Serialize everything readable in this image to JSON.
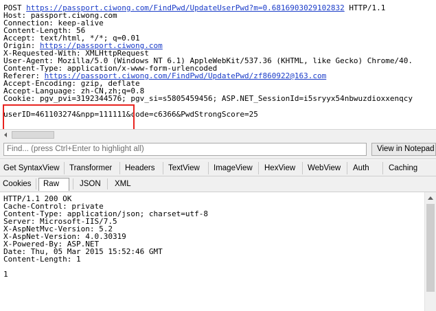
{
  "request": {
    "lines": [
      {
        "parts": [
          {
            "t": "POST "
          },
          {
            "t": "https://passport.ciwong.com/FindPwd/UpdateUserPwd?m=0.6816903029102832",
            "link": true
          },
          {
            "t": " HTTP/1.1"
          }
        ]
      },
      {
        "parts": [
          {
            "t": "Host: passport.ciwong.com"
          }
        ]
      },
      {
        "parts": [
          {
            "t": "Connection: keep-alive"
          }
        ]
      },
      {
        "parts": [
          {
            "t": "Content-Length: 56"
          }
        ]
      },
      {
        "parts": [
          {
            "t": "Accept: text/html, */*; q=0.01"
          }
        ]
      },
      {
        "parts": [
          {
            "t": "Origin: "
          },
          {
            "t": "https://passport.ciwong.com",
            "link": true
          }
        ]
      },
      {
        "parts": [
          {
            "t": "X-Requested-With: XMLHttpRequest"
          }
        ]
      },
      {
        "parts": [
          {
            "t": "User-Agent: Mozilla/5.0 (Windows NT 6.1) AppleWebKit/537.36 (KHTML, like Gecko) Chrome/40."
          }
        ]
      },
      {
        "parts": [
          {
            "t": "Content-Type: application/x-www-form-urlencoded"
          }
        ]
      },
      {
        "parts": [
          {
            "t": "Referer: "
          },
          {
            "t": "https://passport.ciwong.com/FindPwd/UpdatePwd/zf860922@163.com",
            "link": true
          }
        ]
      },
      {
        "parts": [
          {
            "t": "Accept-Encoding: gzip, deflate"
          }
        ]
      },
      {
        "parts": [
          {
            "t": "Accept-Language: zh-CN,zh;q=0.8"
          }
        ]
      },
      {
        "parts": [
          {
            "t": "Cookie: pgv_pvi=3192344576; pgv_si=s5805459456; ASP.NET_SessionId=i5sryyx54nbwuzdioxxenqcy"
          }
        ]
      },
      {
        "parts": [
          {
            "t": ""
          }
        ]
      },
      {
        "parts": [
          {
            "t": "userID=461103274&npp=111111&code=c6366&PwdStrongScore=25"
          }
        ]
      }
    ]
  },
  "find": {
    "placeholder": "Find... (press Ctrl+Enter to highlight all)",
    "notepad_label": "View in Notepad"
  },
  "tabs_row1": [
    "Get SyntaxView",
    "Transformer",
    "Headers",
    "TextView",
    "ImageView",
    "HexView",
    "WebView",
    "Auth",
    "Caching"
  ],
  "tabs_row2": [
    "Cookies",
    "Raw",
    "JSON",
    "XML"
  ],
  "tabs_row2_selected": "Raw",
  "response": {
    "lines": [
      "HTTP/1.1 200 OK",
      "Cache-Control: private",
      "Content-Type: application/json; charset=utf-8",
      "Server: Microsoft-IIS/7.5",
      "X-AspNetMvc-Version: 5.2",
      "X-AspNet-Version: 4.0.30319",
      "X-Powered-By: ASP.NET",
      "Date: Thu, 05 Mar 2015 15:52:46 GMT",
      "Content-Length: 1",
      "",
      "1"
    ]
  },
  "colors": {
    "link": "#1a3cc8",
    "highlight_box": "#e8231f",
    "panel_bg": "#f0f0f0"
  }
}
